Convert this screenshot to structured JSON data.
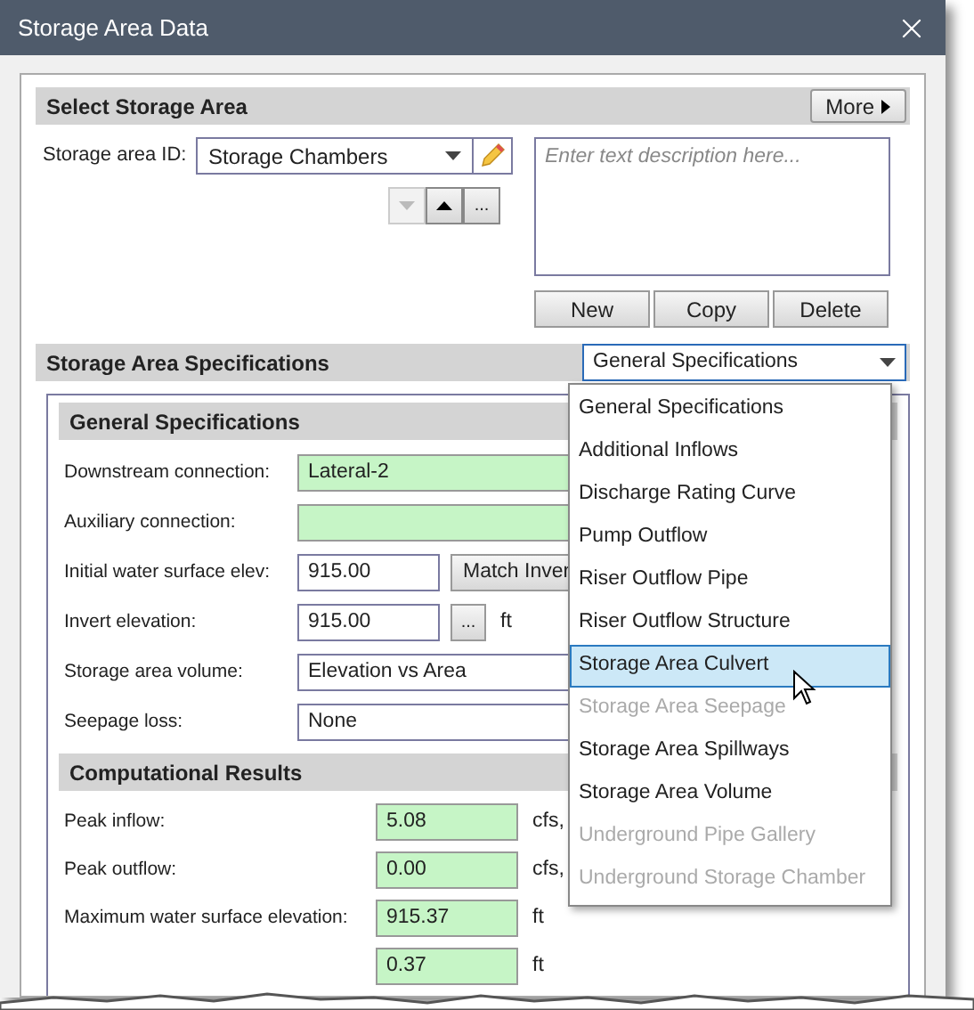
{
  "window": {
    "title": "Storage Area Data"
  },
  "select_section": {
    "title": "Select Storage Area",
    "more_button": "More",
    "id_label": "Storage area ID:",
    "id_value": "Storage Chambers",
    "description_placeholder": "Enter text description here...",
    "nav_down_disabled": true,
    "ellipsis_button": "...",
    "buttons": [
      "New",
      "Copy",
      "Delete"
    ]
  },
  "specs_section": {
    "title": "Storage Area Specifications",
    "dropdown_value": "General Specifications",
    "dropdown_options": [
      {
        "label": "General Specifications",
        "disabled": false,
        "selected": false
      },
      {
        "label": "Additional Inflows",
        "disabled": false,
        "selected": false
      },
      {
        "label": "Discharge Rating Curve",
        "disabled": false,
        "selected": false
      },
      {
        "label": "Pump Outflow",
        "disabled": false,
        "selected": false
      },
      {
        "label": "Riser Outflow Pipe",
        "disabled": false,
        "selected": false
      },
      {
        "label": "Riser Outflow Structure",
        "disabled": false,
        "selected": false
      },
      {
        "label": "Storage Area Culvert",
        "disabled": false,
        "selected": true
      },
      {
        "label": "Storage Area Seepage",
        "disabled": true,
        "selected": false
      },
      {
        "label": "Storage Area Spillways",
        "disabled": false,
        "selected": false
      },
      {
        "label": "Storage Area Volume",
        "disabled": false,
        "selected": false
      },
      {
        "label": "Underground Pipe Gallery",
        "disabled": true,
        "selected": false
      },
      {
        "label": "Underground Storage Chamber",
        "disabled": true,
        "selected": false
      }
    ]
  },
  "general": {
    "title": "General Specifications",
    "rows": [
      {
        "kind": "green",
        "label": "Downstream connection:",
        "value": "Lateral-2"
      },
      {
        "kind": "green",
        "label": "Auxiliary connection:"
      },
      {
        "kind": "button",
        "label": "Initial water surface elev:",
        "value": "915.00",
        "button": "Match Inver"
      },
      {
        "kind": "ellipsis",
        "label": "Invert elevation:",
        "value": "915.00",
        "button": "...",
        "unit": "ft"
      },
      {
        "kind": "select",
        "label": "Storage area volume:",
        "value": "Elevation vs Area"
      },
      {
        "kind": "select",
        "label": "Seepage loss:",
        "value": "None"
      }
    ]
  },
  "results": {
    "title": "Computational Results",
    "rows": [
      {
        "label": "Peak inflow:",
        "value": "5.08",
        "unit": "cfs,"
      },
      {
        "label": "Peak outflow:",
        "value": "0.00",
        "unit": "cfs,"
      },
      {
        "label": "Maximum water surface elevation:",
        "value": "915.37",
        "unit": "ft"
      },
      {
        "value": "0.37",
        "unit": "ft"
      }
    ]
  }
}
